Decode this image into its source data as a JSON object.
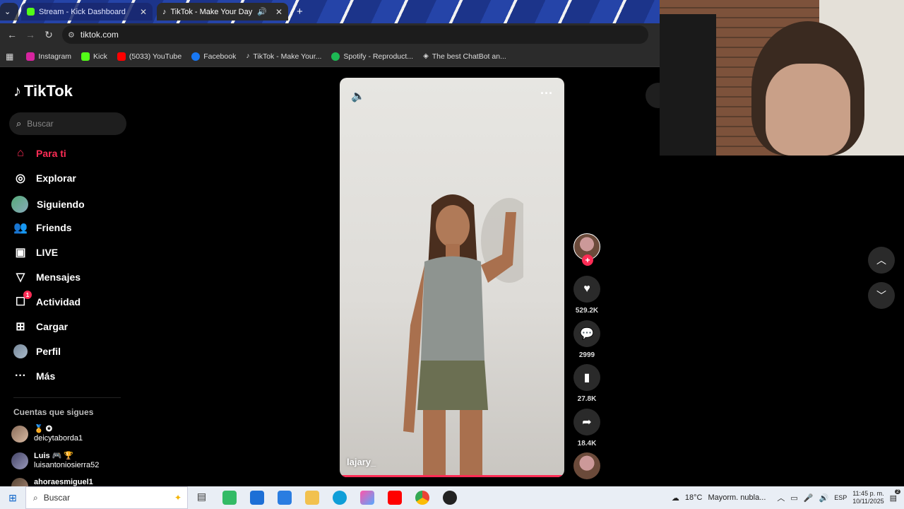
{
  "browser": {
    "tabs": [
      {
        "title": "Stream - Kick Dashboard",
        "active": false
      },
      {
        "title": "TikTok - Make Your Day",
        "active": true
      }
    ],
    "url": "tiktok.com",
    "bookmarks": [
      {
        "label": "Instagram",
        "color": "#d6249f"
      },
      {
        "label": "Kick",
        "color": "#53fc18"
      },
      {
        "label": "(5033) YouTube",
        "color": "#ff0000"
      },
      {
        "label": "Facebook",
        "color": "#1877f2"
      },
      {
        "label": "TikTok - Make Your...",
        "color": "#111111"
      },
      {
        "label": "Spotify - Reproduct...",
        "color": "#1db954"
      },
      {
        "label": "The best ChatBot an...",
        "color": "#ffffff"
      }
    ]
  },
  "tiktok": {
    "logo": "TikTok",
    "search_placeholder": "Buscar",
    "nav": [
      {
        "label": "Para ti",
        "icon": "home-icon",
        "active": true
      },
      {
        "label": "Explorar",
        "icon": "compass-icon"
      },
      {
        "label": "Siguiendo",
        "icon": "following-avatar-icon"
      },
      {
        "label": "Friends",
        "icon": "friends-icon"
      },
      {
        "label": "LIVE",
        "icon": "live-icon"
      },
      {
        "label": "Mensajes",
        "icon": "messages-icon"
      },
      {
        "label": "Actividad",
        "icon": "activity-icon",
        "badge": "1"
      },
      {
        "label": "Cargar",
        "icon": "upload-icon"
      },
      {
        "label": "Perfil",
        "icon": "profile-icon"
      },
      {
        "label": "Más",
        "icon": "more-icon"
      }
    ],
    "following_title": "Cuentas que sigues",
    "accounts": [
      {
        "top": "🏅 ✪",
        "name": "deicytaborda1"
      },
      {
        "top": "Luis 🎮 🏆",
        "name": "luisantoniosierra52"
      },
      {
        "top": "",
        "name": "ahoraesmiguel1"
      }
    ],
    "video": {
      "username": "lajary_",
      "progress": 1.0
    },
    "actions": {
      "likes": "529.2K",
      "comments": "2999",
      "saves": "27.8K",
      "shares": "18.4K"
    }
  },
  "taskbar": {
    "search": "Buscar",
    "weather": "18°C",
    "weather_text": "Mayorm. nubla...",
    "lang": "ESP",
    "time": "11:45 p. m.",
    "date": "10/11/2025",
    "notif_count": "2"
  }
}
